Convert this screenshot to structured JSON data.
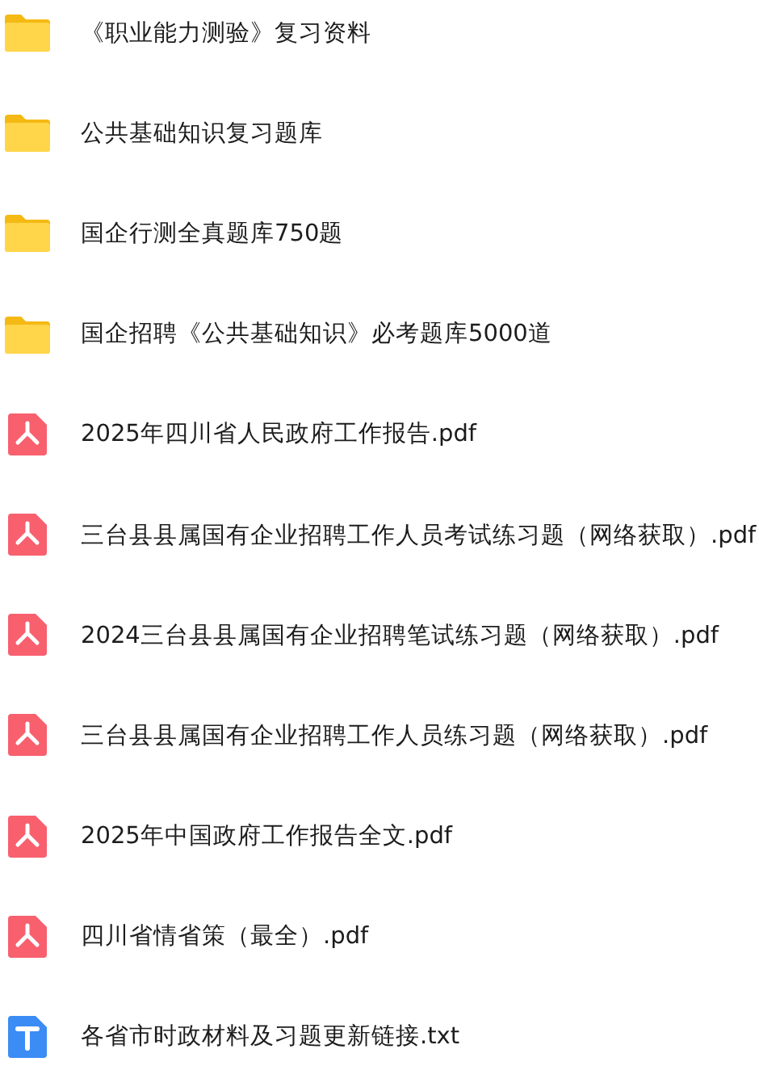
{
  "files": [
    {
      "kind": "folder",
      "name": "《职业能力测验》复习资料"
    },
    {
      "kind": "folder",
      "name": "公共基础知识复习题库"
    },
    {
      "kind": "folder",
      "name": "国企行测全真题库750题"
    },
    {
      "kind": "folder",
      "name": "国企招聘《公共基础知识》必考题库5000道"
    },
    {
      "kind": "pdf",
      "name": "2025年四川省人民政府工作报告.pdf"
    },
    {
      "kind": "pdf",
      "name": "三台县县属国有企业招聘工作人员考试练习题（网络获取）.pdf"
    },
    {
      "kind": "pdf",
      "name": "2024三台县县属国有企业招聘笔试练习题（网络获取）.pdf"
    },
    {
      "kind": "pdf",
      "name": "三台县县属国有企业招聘工作人员练习题（网络获取）.pdf"
    },
    {
      "kind": "pdf",
      "name": "2025年中国政府工作报告全文.pdf"
    },
    {
      "kind": "pdf",
      "name": "四川省情省策（最全）.pdf"
    },
    {
      "kind": "txt",
      "name": "各省市时政材料及习题更新链接.txt"
    }
  ]
}
